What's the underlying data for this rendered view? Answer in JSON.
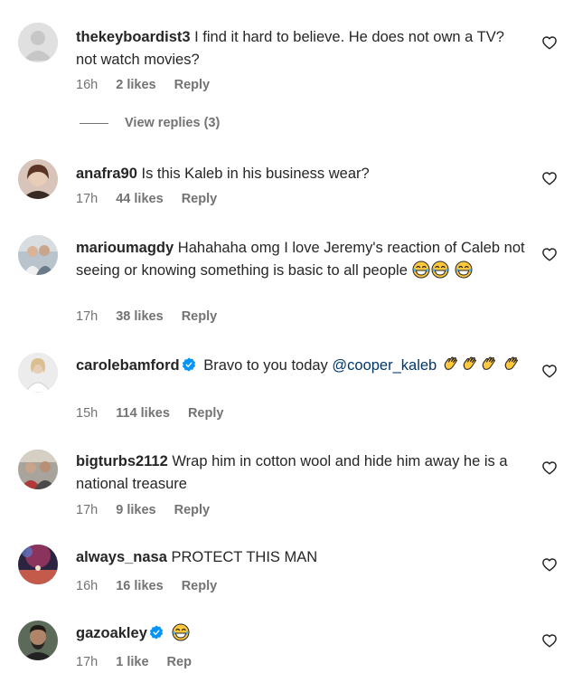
{
  "comments": [
    {
      "username": "thekeyboardist3",
      "text": "I find it hard to believe. He does not own a TV? not watch movies?",
      "time": "16h",
      "likes": "2 likes",
      "reply": "Reply",
      "view_replies": "View replies (3)",
      "avatar": "default-avatar"
    },
    {
      "username": "anafra90",
      "text": "Is this Kaleb in his business wear?",
      "time": "17h",
      "likes": "44 likes",
      "reply": "Reply",
      "avatar": "woman-avatar"
    },
    {
      "username": "marioumagdy",
      "text": "Hahahaha omg I love Jeremy's reaction of Caleb not seeing or knowing something is basic to all people",
      "emojis": [
        "tears-of-joy-emoji",
        "tears-of-joy-emoji",
        "tears-of-joy-emoji"
      ],
      "time": "17h",
      "likes": "38 likes",
      "reply": "Reply",
      "avatar": "man-avatar"
    },
    {
      "username": "carolebamford",
      "verified": true,
      "text_before": "Bravo to you today",
      "mention": "@cooper_kaleb",
      "emojis": [
        "clapping-hands-emoji",
        "clapping-hands-emoji",
        "clapping-hands-emoji",
        "clapping-hands-emoji"
      ],
      "time": "15h",
      "likes": "114 likes",
      "reply": "Reply",
      "avatar": "woman-white-avatar"
    },
    {
      "username": "bigturbs2112",
      "text": "Wrap him in cotton wool and hide him away he is a national treasure",
      "time": "17h",
      "likes": "9 likes",
      "reply": "Reply",
      "avatar": "group-avatar"
    },
    {
      "username": "always_nasa",
      "text": "PROTECT THIS MAN",
      "time": "16h",
      "likes": "16 likes",
      "reply": "Reply",
      "avatar": "stage-avatar"
    },
    {
      "username": "gazoakley",
      "verified": true,
      "emojis": [
        "tears-of-joy-emoji"
      ],
      "time": "17h",
      "likes": "1 like",
      "reply": "Rep",
      "avatar": "bearded-man-avatar"
    }
  ],
  "colors": {
    "text": "#262626",
    "meta": "#737373",
    "mention": "#00376b",
    "verified": "#0095f6"
  }
}
